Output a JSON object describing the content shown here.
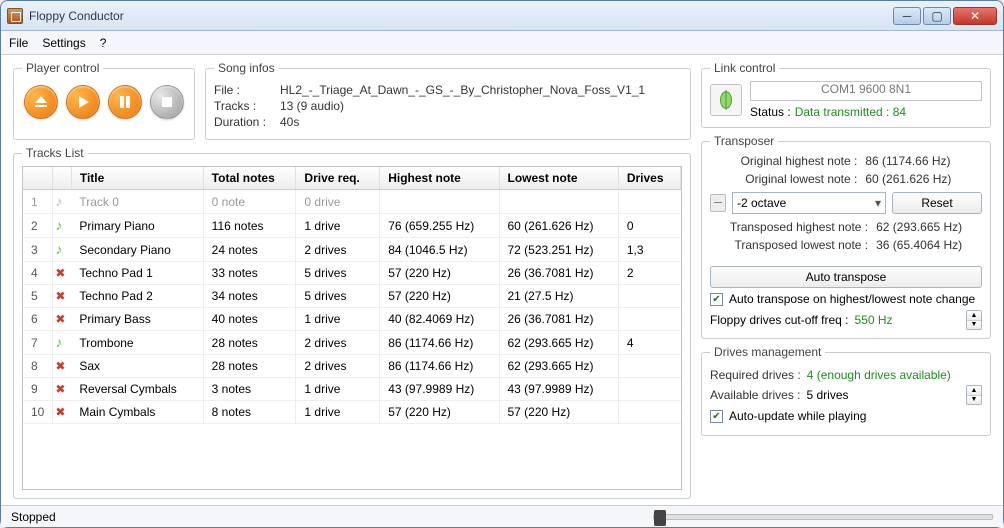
{
  "window": {
    "title": "Floppy Conductor"
  },
  "menu": {
    "file": "File",
    "settings": "Settings",
    "help": "?"
  },
  "player": {
    "legend": "Player control"
  },
  "song": {
    "legend": "Song infos",
    "file_label": "File :",
    "file_value": "HL2_-_Triage_At_Dawn_-_GS_-_By_Christopher_Nova_Foss_V1_1",
    "tracks_label": "Tracks :",
    "tracks_value": "13 (9 audio)",
    "duration_label": "Duration :",
    "duration_value": "40s"
  },
  "link": {
    "legend": "Link control",
    "port": "COM1 9600 8N1",
    "status_label": "Status :",
    "status_value": "Data transmitted : 84"
  },
  "tracks_list": {
    "legend": "Tracks List",
    "headers": {
      "title": "Title",
      "total": "Total notes",
      "req": "Drive req.",
      "high": "Highest note",
      "low": "Lowest note",
      "drives": "Drives"
    },
    "rows": [
      {
        "idx": "1",
        "icon": "gray",
        "title": "Track 0",
        "total": "0 note",
        "req": "0 drive",
        "high": "",
        "low": "",
        "drives": "",
        "muted": true
      },
      {
        "idx": "2",
        "icon": "green",
        "title": "Primary Piano",
        "total": "116 notes",
        "req": "1 drive",
        "high": "76 (659.255 Hz)",
        "low": "60 (261.626 Hz)",
        "drives": "0"
      },
      {
        "idx": "3",
        "icon": "green",
        "title": "Secondary Piano",
        "total": "24 notes",
        "req": "2 drives",
        "high": "84 (1046.5 Hz)",
        "low": "72 (523.251 Hz)",
        "drives": "1,3"
      },
      {
        "idx": "4",
        "icon": "x",
        "title": "Techno Pad 1",
        "total": "33 notes",
        "req": "5 drives",
        "high": "57 (220 Hz)",
        "low": "26 (36.7081 Hz)",
        "drives": "2"
      },
      {
        "idx": "5",
        "icon": "x",
        "title": "Techno Pad 2",
        "total": "34 notes",
        "req": "5 drives",
        "high": "57 (220 Hz)",
        "low": "21 (27.5 Hz)",
        "drives": ""
      },
      {
        "idx": "6",
        "icon": "x",
        "title": "Primary Bass",
        "total": "40 notes",
        "req": "1 drive",
        "high": "40 (82.4069 Hz)",
        "low": "26 (36.7081 Hz)",
        "drives": ""
      },
      {
        "idx": "7",
        "icon": "green",
        "title": "Trombone",
        "total": "28 notes",
        "req": "2 drives",
        "high": "86 (1174.66 Hz)",
        "low": "62 (293.665 Hz)",
        "drives": "4"
      },
      {
        "idx": "8",
        "icon": "x",
        "title": "Sax",
        "total": "28 notes",
        "req": "2 drives",
        "high": "86 (1174.66 Hz)",
        "low": "62 (293.665 Hz)",
        "drives": ""
      },
      {
        "idx": "9",
        "icon": "x",
        "title": "Reversal Cymbals",
        "total": "3 notes",
        "req": "1 drive",
        "high": "43 (97.9989 Hz)",
        "low": "43 (97.9989 Hz)",
        "drives": ""
      },
      {
        "idx": "10",
        "icon": "x",
        "title": "Main Cymbals",
        "total": "8 notes",
        "req": "1 drive",
        "high": "57 (220 Hz)",
        "low": "57 (220 Hz)",
        "drives": ""
      }
    ]
  },
  "transposer": {
    "legend": "Transposer",
    "orig_high_label": "Original highest note :",
    "orig_high_value": "86 (1174.66 Hz)",
    "orig_low_label": "Original lowest note :",
    "orig_low_value": "60 (261.626 Hz)",
    "octave_value": "-2 octave",
    "reset_label": "Reset",
    "trans_high_label": "Transposed highest note :",
    "trans_high_value": "62 (293.665 Hz)",
    "trans_low_label": "Transposed lowest note :",
    "trans_low_value": "36 (65.4064 Hz)",
    "auto_btn": "Auto transpose",
    "auto_chk": "Auto transpose on highest/lowest note change",
    "cutoff_label": "Floppy drives cut-off freq :",
    "cutoff_value": "550 Hz"
  },
  "drives": {
    "legend": "Drives management",
    "required_label": "Required drives :",
    "required_value": "4 (enough drives available)",
    "available_label": "Available drives :",
    "available_value": "5 drives",
    "auto_update": "Auto-update while playing"
  },
  "status": {
    "text": "Stopped"
  }
}
